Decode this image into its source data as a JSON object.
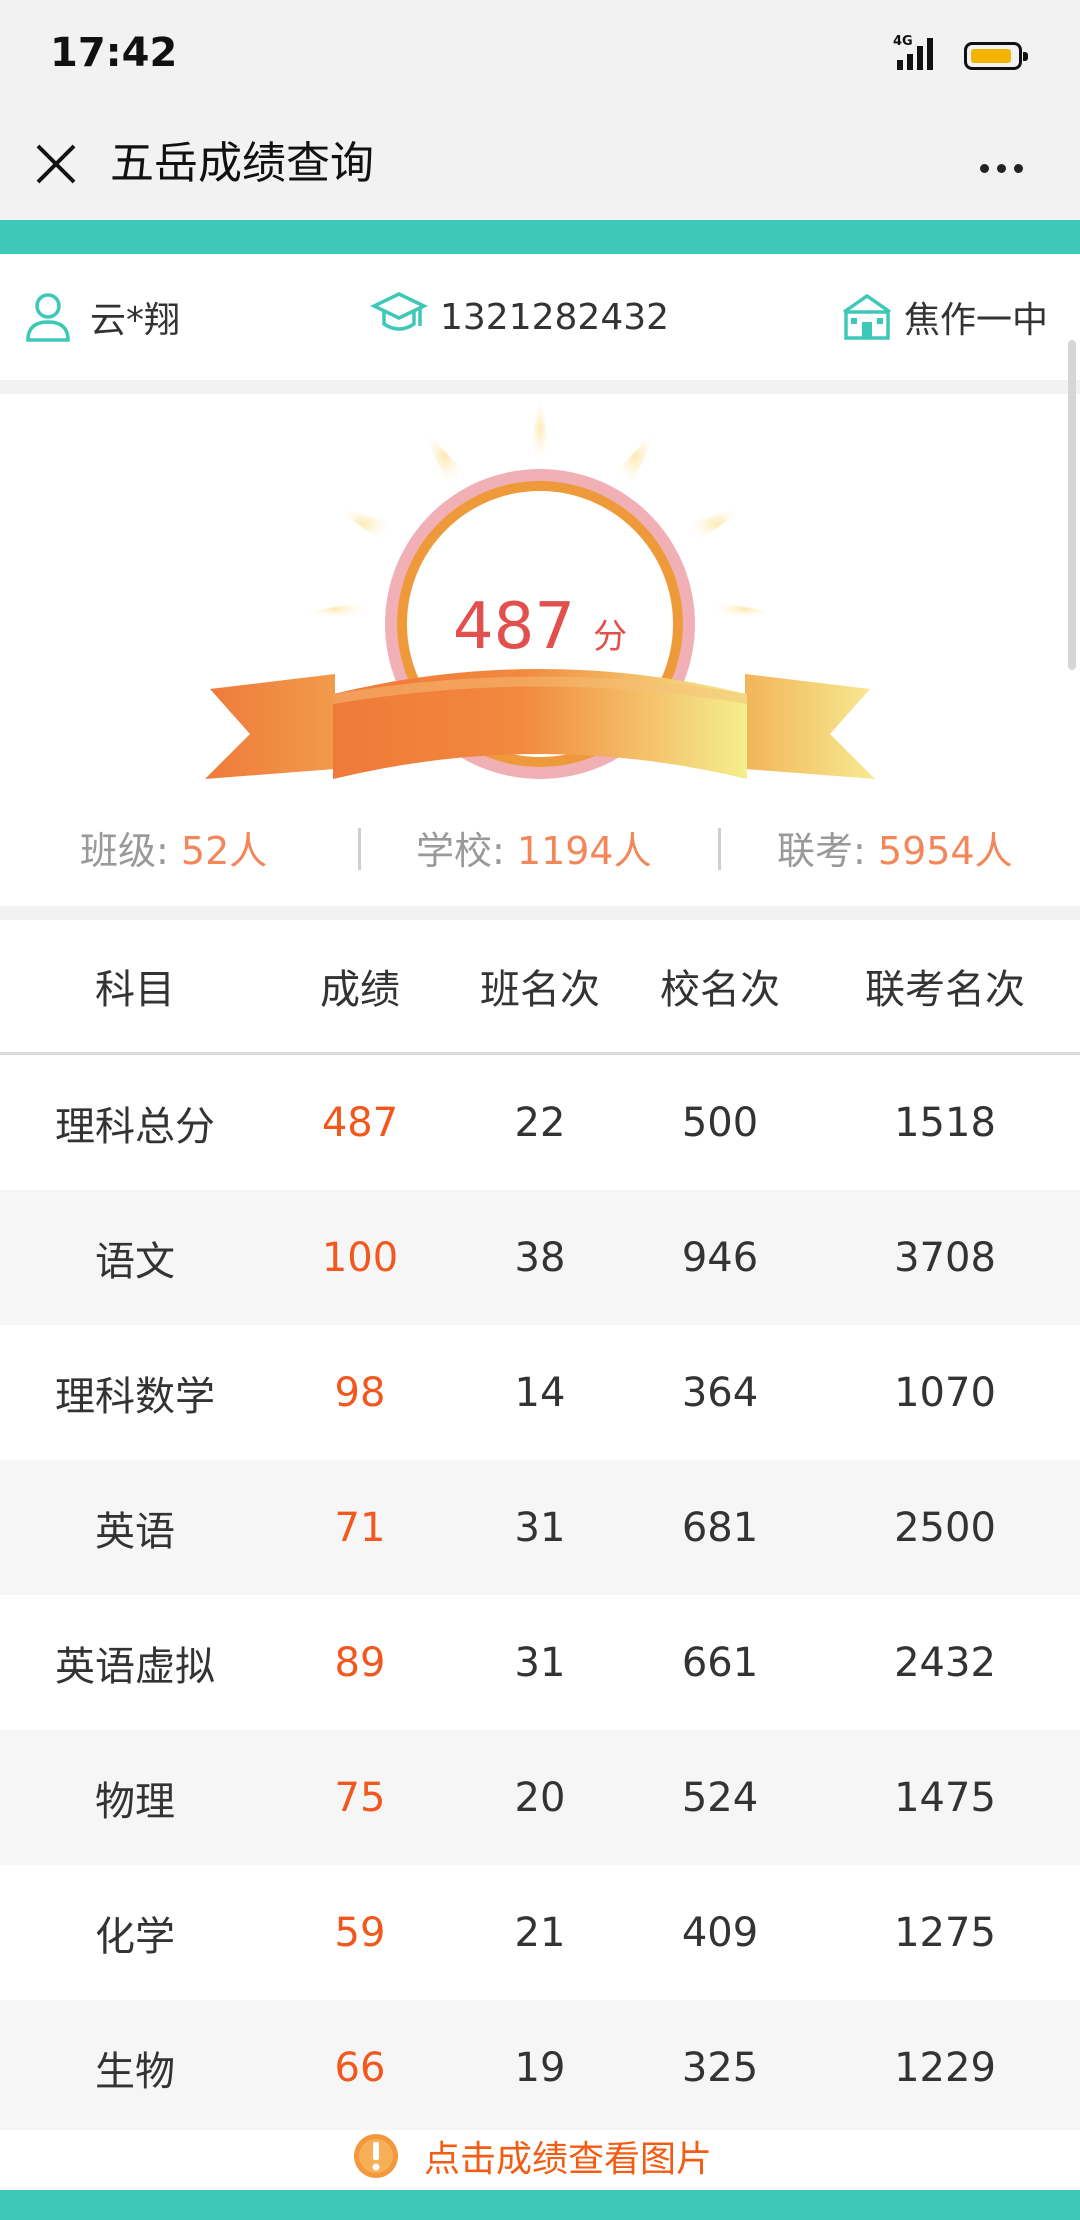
{
  "status_bar": {
    "time": "17:42",
    "network": "4G"
  },
  "nav": {
    "title": "五岳成绩查询"
  },
  "user_info": {
    "name": "云*翔",
    "id": "1321282432",
    "school": "焦作一中"
  },
  "score": {
    "total": "487",
    "unit": "分"
  },
  "counts": {
    "class_label": "班级: ",
    "class_value": "52人",
    "school_label": "学校: ",
    "school_value": "1194人",
    "joint_label": "联考: ",
    "joint_value": "5954人"
  },
  "table": {
    "headers": [
      "科目",
      "成绩",
      "班名次",
      "校名次",
      "联考名次"
    ],
    "rows": [
      [
        "理科总分",
        "487",
        "22",
        "500",
        "1518"
      ],
      [
        "语文",
        "100",
        "38",
        "946",
        "3708"
      ],
      [
        "理科数学",
        "98",
        "14",
        "364",
        "1070"
      ],
      [
        "英语",
        "71",
        "31",
        "681",
        "2500"
      ],
      [
        "英语虚拟",
        "89",
        "31",
        "661",
        "2432"
      ],
      [
        "物理",
        "75",
        "20",
        "524",
        "1475"
      ],
      [
        "化学",
        "59",
        "21",
        "409",
        "1275"
      ],
      [
        "生物",
        "66",
        "19",
        "325",
        "1229"
      ]
    ]
  },
  "footer": {
    "hint": "点击成绩查看图片"
  },
  "colors": {
    "teal": "#3ec8b8",
    "score_red": "#e2504d",
    "grade_orange": "#f2581e",
    "count_orange": "#f4875a"
  },
  "icons": [
    "close-icon",
    "more-icon",
    "user-icon",
    "graduation-cap-icon",
    "school-icon",
    "info-icon",
    "signal-icon",
    "battery-icon"
  ]
}
